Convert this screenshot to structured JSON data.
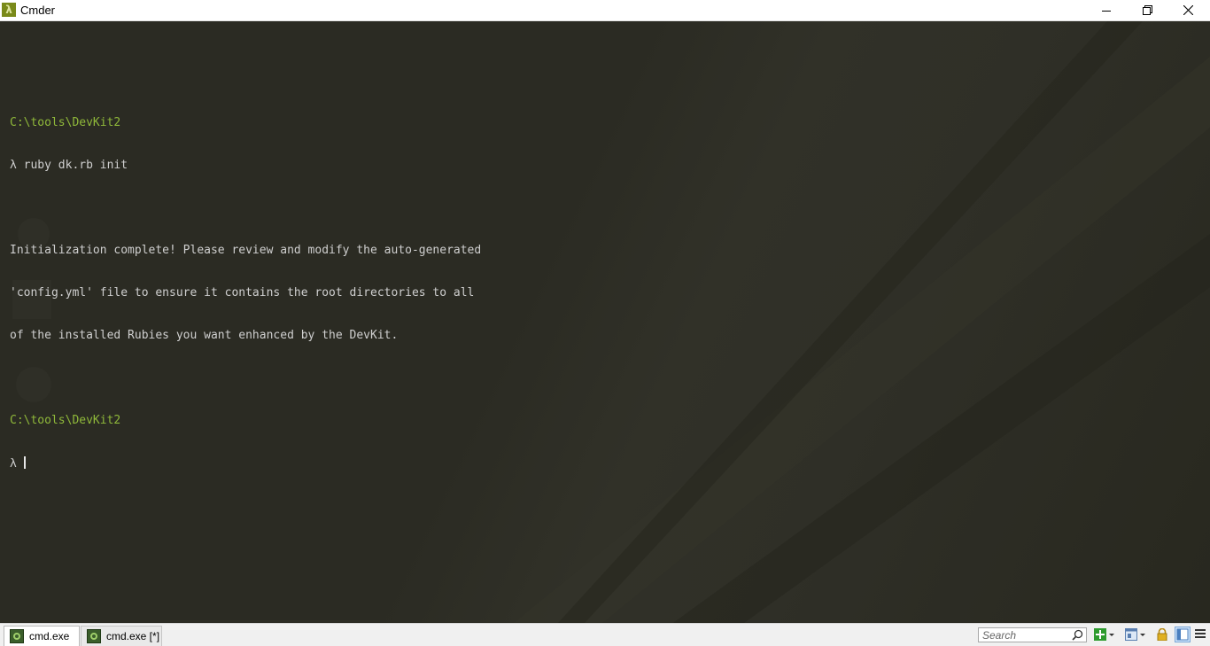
{
  "window": {
    "title": "Cmder",
    "app_icon_glyph": "λ"
  },
  "terminal": {
    "lines": [
      {
        "kind": "blank",
        "text": ""
      },
      {
        "kind": "path",
        "text": "C:\\tools\\DevKit2"
      },
      {
        "kind": "cmd",
        "text": "λ ruby dk.rb init"
      },
      {
        "kind": "blank",
        "text": ""
      },
      {
        "kind": "out",
        "text": "Initialization complete! Please review and modify the auto-generated"
      },
      {
        "kind": "out",
        "text": "'config.yml' file to ensure it contains the root directories to all"
      },
      {
        "kind": "out",
        "text": "of the installed Rubies you want enhanced by the DevKit."
      },
      {
        "kind": "blank",
        "text": ""
      },
      {
        "kind": "path",
        "text": "C:\\tools\\DevKit2"
      }
    ],
    "prompt": "λ "
  },
  "statusbar": {
    "tabs": [
      {
        "label": "cmd.exe",
        "active": true
      },
      {
        "label": "cmd.exe [*]",
        "active": false
      }
    ],
    "search_placeholder": "Search"
  },
  "colors": {
    "path": "#8fb83a",
    "text": "#cfcfcf",
    "background": "#2b2b23"
  },
  "icons": {
    "minimize": "minimize-icon",
    "maximize": "restore-icon",
    "close": "close-icon",
    "new_console": "plus-icon",
    "lock": "lock-icon",
    "menu": "hamburger-icon"
  }
}
